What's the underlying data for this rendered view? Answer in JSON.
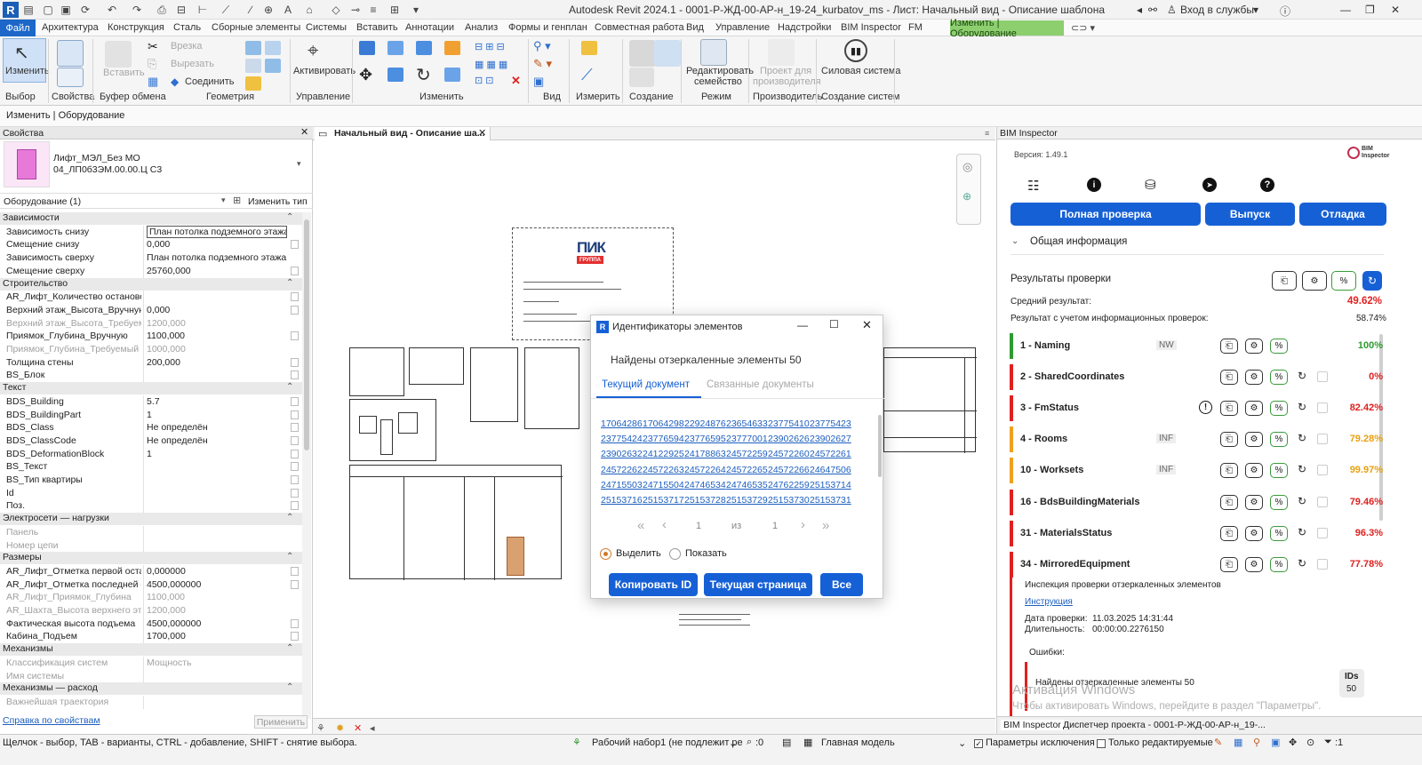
{
  "app": {
    "title": "Autodesk Revit 2024.1 - 0001-Р-ЖД-00-АР-н_19-24_kurbatov_ms - Лист: Начальный вид - Описание шаблона",
    "login": "Вход в службы",
    "help": "?"
  },
  "ribbon_tabs": [
    "Архитектура",
    "Конструкция",
    "Сталь",
    "Сборные элементы",
    "Системы",
    "Вставить",
    "Аннотации",
    "Анализ",
    "Формы и генплан",
    "Совместная работа",
    "Вид",
    "Управление",
    "Надстройки",
    "BIM Inspector",
    "FM"
  ],
  "file_tab": "Файл",
  "context_tab": "Изменить | Оборудование",
  "ribbon": {
    "modify": "Изменить",
    "select_panel": "Выбор",
    "properties_panel": "Свойства",
    "clipboard_panel": "Буфер обмена",
    "paste": "Вставить",
    "cut": "Врезка",
    "uncut": "Вырезать",
    "join": "Соединить",
    "geometry_panel": "Геометрия",
    "activate": "Активировать",
    "control_panel": "Управление",
    "modify_panel": "Изменить",
    "view_panel": "Вид",
    "measure_panel": "Измерить",
    "create_panel": "Создание",
    "edit_family_1": "Редактировать",
    "edit_family_2": "семейство",
    "mode_panel": "Режим",
    "project_1": "Проект для",
    "project_2": "производителя",
    "producer_panel": "Производитель",
    "power_system": "Силовая система",
    "create_systems_panel": "Создание систем"
  },
  "options_bar": "Изменить | Оборудование",
  "properties": {
    "header": "Свойства",
    "type_name_1": "Лифт_МЭЛ_Без МО",
    "type_name_2": "04_ЛП0б3ЭМ.00.00.Ц С3",
    "filter": "Оборудование (1)",
    "edit_type": "Изменить тип",
    "groups": [
      {
        "title": "Зависимости",
        "rows": [
          {
            "k": "Зависимость снизу",
            "v": "План потолка подземного этажа",
            "dim": false,
            "cb": false
          },
          {
            "k": "Смещение снизу",
            "v": "0,000",
            "dim": false,
            "cb": true
          },
          {
            "k": "Зависимость сверху",
            "v": "План потолка подземного этажа",
            "dim": false,
            "cb": false
          },
          {
            "k": "Смещение сверху",
            "v": "25760,000",
            "dim": false,
            "cb": true
          }
        ]
      },
      {
        "title": "Строительство",
        "rows": [
          {
            "k": "AR_Лифт_Количество остановок",
            "v": "",
            "dim": false,
            "cb": true
          },
          {
            "k": "Верхний этаж_Высота_Вручную",
            "v": "0,000",
            "dim": false,
            "cb": true
          },
          {
            "k": "Верхний этаж_Высота_Требуем...",
            "v": "1200,000",
            "dim": true,
            "cb": false
          },
          {
            "k": "Приямок_Глубина_Вручную",
            "v": "1100,000",
            "dim": false,
            "cb": true
          },
          {
            "k": "Приямок_Глубина_Требуемый ...",
            "v": "1000,000",
            "dim": true,
            "cb": false
          },
          {
            "k": "Толщина стены",
            "v": "200,000",
            "dim": false,
            "cb": true
          },
          {
            "k": "BS_Блок",
            "v": "",
            "dim": false,
            "cb": true
          }
        ]
      },
      {
        "title": "Текст",
        "rows": [
          {
            "k": "BDS_Building",
            "v": "5.7",
            "dim": false,
            "cb": true
          },
          {
            "k": "BDS_BuildingPart",
            "v": "1",
            "dim": false,
            "cb": true
          },
          {
            "k": "BDS_Class",
            "v": "Не определён",
            "dim": false,
            "cb": true
          },
          {
            "k": "BDS_ClassCode",
            "v": "Не определён",
            "dim": false,
            "cb": true
          },
          {
            "k": "BDS_DeformationBlock",
            "v": "1",
            "dim": false,
            "cb": true
          },
          {
            "k": "BS_Текст",
            "v": "",
            "dim": false,
            "cb": true
          },
          {
            "k": "BS_Тип квартиры",
            "v": "",
            "dim": false,
            "cb": true
          },
          {
            "k": "Id",
            "v": "",
            "dim": false,
            "cb": true
          },
          {
            "k": "Поз.",
            "v": "",
            "dim": false,
            "cb": true
          }
        ]
      },
      {
        "title": "Электросети — нагрузки",
        "rows": [
          {
            "k": "Панель",
            "v": "",
            "dim": true,
            "cb": false
          },
          {
            "k": "Номер цепи",
            "v": "",
            "dim": true,
            "cb": false
          }
        ]
      },
      {
        "title": "Размеры",
        "rows": [
          {
            "k": "AR_Лифт_Отметка первой остан...",
            "v": "0,000000",
            "dim": false,
            "cb": true
          },
          {
            "k": "AR_Лифт_Отметка последней ос...",
            "v": "4500,000000",
            "dim": false,
            "cb": true
          },
          {
            "k": "AR_Лифт_Приямок_Глубина",
            "v": "1100,000",
            "dim": true,
            "cb": false
          },
          {
            "k": "AR_Шахта_Высота верхнего этажа",
            "v": "1200,000",
            "dim": true,
            "cb": false
          },
          {
            "k": "Фактическая высота подъема",
            "v": "4500,000000",
            "dim": false,
            "cb": true
          },
          {
            "k": "Кабина_Подъем",
            "v": "1700,000",
            "dim": false,
            "cb": true
          }
        ]
      },
      {
        "title": "Механизмы",
        "rows": [
          {
            "k": "Классификация систем",
            "v": "Мощность",
            "dim": true,
            "cb": false
          },
          {
            "k": "Имя системы",
            "v": "",
            "dim": true,
            "cb": false
          }
        ]
      },
      {
        "title": "Механизмы — расход",
        "rows": [
          {
            "k": "Важнейшая траектория",
            "v": "",
            "dim": true,
            "cb": false
          }
        ]
      }
    ],
    "help_link": "Справка по свойствам",
    "apply": "Применить"
  },
  "view": {
    "tab": "Начальный вид - Описание ша..."
  },
  "dialog": {
    "title": "Идентификаторы элементов",
    "found": "Найдены отзеркаленные элементы 50",
    "tab_current": "Текущий документ",
    "tab_linked": "Связанные документы",
    "ids": [
      [
        "17064286",
        "17064298",
        "22924876",
        "23654633",
        "23775410",
        "23775423"
      ],
      [
        "23775424",
        "23776594",
        "23776595",
        "23777001",
        "23902626",
        "23902627"
      ],
      [
        "23902632",
        "24122925",
        "24178863",
        "24572259",
        "24572260",
        "24572261"
      ],
      [
        "24572262",
        "24572263",
        "24572264",
        "24572265",
        "24572266",
        "24647506"
      ],
      [
        "24715503",
        "24715504",
        "24746534",
        "24746535",
        "24762259",
        "25153714"
      ],
      [
        "25153716",
        "25153717",
        "25153728",
        "25153729",
        "25153730",
        "25153731"
      ]
    ],
    "page_current": "1",
    "page_of": "из",
    "page_total": "1",
    "radio_select": "Выделить",
    "radio_show": "Показать",
    "btn_copy": "Копировать ID",
    "btn_page": "Текущая страница",
    "btn_all": "Все"
  },
  "bim": {
    "header": "BIM Inspector",
    "version": "Версия: 1.49.1",
    "logo_text_1": "BIM",
    "logo_text_2": "Inspector",
    "btn_full": "Полная проверка",
    "btn_release": "Выпуск",
    "btn_debug": "Отладка",
    "general": "Общая информация",
    "results": "Результаты проверки",
    "avg_label": "Средний результат:",
    "avg_value": "49.62%",
    "info_label": "Результат с учетом информационных проверок:",
    "info_value": "58.74%",
    "checks": [
      {
        "name": "1 - Naming",
        "tag": "NW",
        "pct": "100%",
        "color": "#2e9b2e",
        "pctColor": "#2e9b2e",
        "refresh": false,
        "warn": false
      },
      {
        "name": "2 - SharedCoordinates",
        "tag": "",
        "pct": "0%",
        "color": "#e02020",
        "pctColor": "#e02020",
        "refresh": true,
        "warn": false
      },
      {
        "name": "3 - FmStatus",
        "tag": "",
        "pct": "82.42%",
        "color": "#e02020",
        "pctColor": "#e02020",
        "refresh": true,
        "warn": true
      },
      {
        "name": "4 - Rooms",
        "tag": "INF",
        "pct": "79.28%",
        "color": "#f0a020",
        "pctColor": "#e8a010",
        "refresh": true,
        "warn": false
      },
      {
        "name": "10 - Worksets",
        "tag": "INF",
        "pct": "99.97%",
        "color": "#f0a020",
        "pctColor": "#e8a010",
        "refresh": true,
        "warn": false
      },
      {
        "name": "16 - BdsBuildingMaterials",
        "tag": "",
        "pct": "79.46%",
        "color": "#e02020",
        "pctColor": "#e02020",
        "refresh": true,
        "warn": false
      },
      {
        "name": "31 - MaterialsStatus",
        "tag": "",
        "pct": "96.3%",
        "color": "#e02020",
        "pctColor": "#e02020",
        "refresh": true,
        "warn": false
      },
      {
        "name": "34 - MirroredEquipment",
        "tag": "",
        "pct": "77.78%",
        "color": "#e02020",
        "pctColor": "#e02020",
        "refresh": true,
        "warn": false
      }
    ],
    "detail_title": "Инспекция проверки отзеркаленных элементов",
    "instruction": "Инструкция",
    "date_label": "Дата проверки:",
    "date_value": "11.03.2025 14:31:44",
    "dur_label": "Длительность:",
    "dur_value": "00:00:00.2276150",
    "errors": "Ошибки:",
    "error_item": "Найдены отзеркаленные элементы 50",
    "ids_label": "IDs",
    "ids_count": "50",
    "watermark_1": "Активация Windows",
    "watermark_2": "Чтобы активировать Windows, перейдите в раздел \"Параметры\".",
    "bottom_tab1": "BIM Inspector",
    "bottom_tab2": "Диспетчер проекта - 0001-Р-ЖД-00-АР-н_19-..."
  },
  "status": {
    "hint": "Щелчок - выбор, TAB - варианты, CTRL - добавление, SHIFT - снятие выбора.",
    "workset": "Рабочий набор1 (не подлежит ре",
    "count": ":0",
    "model": "Главная модель",
    "excl": "Параметры исключения",
    "edit_only": "Только редактируемые",
    "filter": ":1"
  },
  "sheet": {
    "logo_1": "ПИК",
    "logo_2": "ГРУППА"
  }
}
